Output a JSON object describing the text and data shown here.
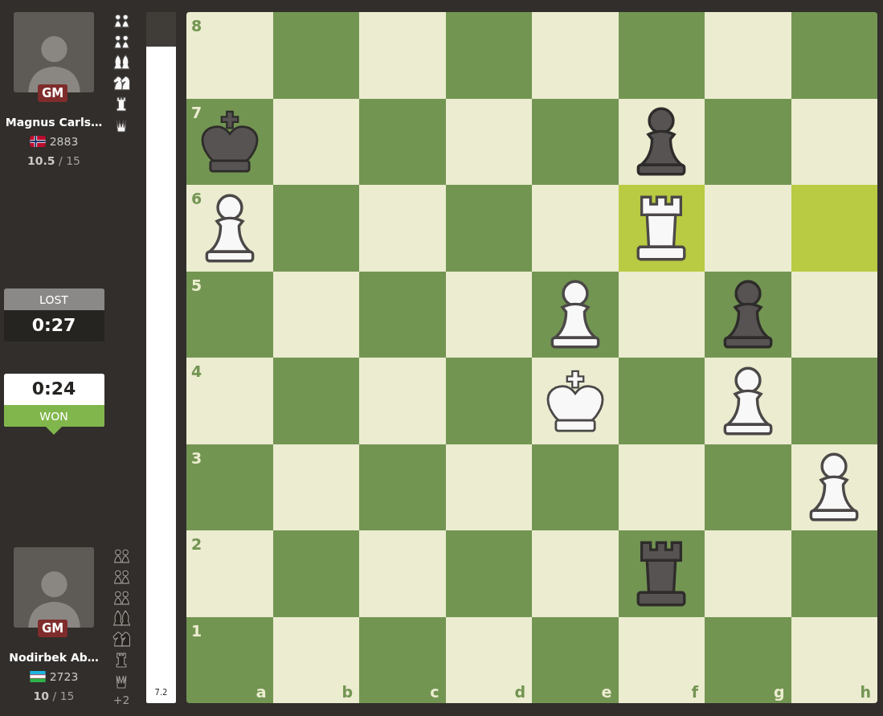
{
  "players": [
    {
      "name": "Magnus Carls…",
      "title": "GM",
      "rating": "2883",
      "score": "**10.5** / 15",
      "captured": [
        {
          "kind": "white_pawn_pair"
        },
        {
          "kind": "white_pawn_pair"
        },
        {
          "kind": "white_bishop_pair"
        },
        {
          "kind": "white_knight_pair"
        },
        {
          "kind": "white_rook"
        },
        {
          "kind": "white_queen"
        }
      ]
    },
    {
      "name": "Nodirbek Ab…",
      "title": "GM",
      "rating": "2723",
      "score": "**10** / 15",
      "captured": [
        {
          "kind": "black_pawn_pair"
        },
        {
          "kind": "black_pawn_pair"
        },
        {
          "kind": "black_pawn_pair"
        },
        {
          "kind": "black_bishop_pair"
        },
        {
          "kind": "black_knight_pair"
        },
        {
          "kind": "black_rook"
        },
        {
          "kind": "black_queen"
        }
      ],
      "advantage": "+2"
    }
  ],
  "clocks": [
    {
      "result": "LOST",
      "time": "0:27",
      "selected": false
    },
    {
      "result": "WON",
      "time": "0:24",
      "selected": true
    }
  ],
  "eval_bar": {
    "level": 0.95,
    "reading": "7.2"
  },
  "board": {
    "rows": [
      {
        "label": "8",
        "squares": [
          {
            "kind": "empty",
            "highlighted": false
          },
          {
            "kind": "empty",
            "highlighted": false
          },
          {
            "kind": "empty",
            "highlighted": false
          },
          {
            "kind": "empty",
            "highlighted": false
          },
          {
            "kind": "empty",
            "highlighted": false
          },
          {
            "kind": "empty",
            "highlighted": false
          },
          {
            "kind": "empty",
            "highlighted": false
          },
          {
            "kind": "empty",
            "highlighted": false
          }
        ]
      },
      {
        "label": "7",
        "squares": [
          {
            "kind": "black_king",
            "highlighted": false
          },
          {
            "kind": "empty",
            "highlighted": false
          },
          {
            "kind": "empty",
            "highlighted": false
          },
          {
            "kind": "empty",
            "highlighted": false
          },
          {
            "kind": "empty",
            "highlighted": false
          },
          {
            "kind": "black_pawn",
            "highlighted": false
          },
          {
            "kind": "empty",
            "highlighted": false
          },
          {
            "kind": "empty",
            "highlighted": false
          }
        ]
      },
      {
        "label": "6",
        "squares": [
          {
            "kind": "white_pawn",
            "highlighted": false
          },
          {
            "kind": "empty",
            "highlighted": false
          },
          {
            "kind": "empty",
            "highlighted": false
          },
          {
            "kind": "empty",
            "highlighted": false
          },
          {
            "kind": "empty",
            "highlighted": false
          },
          {
            "kind": "white_rook",
            "highlighted": true
          },
          {
            "kind": "empty",
            "highlighted": false
          },
          {
            "kind": "empty",
            "highlighted": true
          }
        ]
      },
      {
        "label": "5",
        "squares": [
          {
            "kind": "empty",
            "highlighted": false
          },
          {
            "kind": "empty",
            "highlighted": false
          },
          {
            "kind": "empty",
            "highlighted": false
          },
          {
            "kind": "empty",
            "highlighted": false
          },
          {
            "kind": "white_pawn",
            "highlighted": false
          },
          {
            "kind": "empty",
            "highlighted": false
          },
          {
            "kind": "black_pawn",
            "highlighted": false
          },
          {
            "kind": "empty",
            "highlighted": false
          }
        ]
      },
      {
        "label": "4",
        "squares": [
          {
            "kind": "empty",
            "highlighted": false
          },
          {
            "kind": "empty",
            "highlighted": false
          },
          {
            "kind": "empty",
            "highlighted": false
          },
          {
            "kind": "empty",
            "highlighted": false
          },
          {
            "kind": "white_king",
            "highlighted": false
          },
          {
            "kind": "empty",
            "highlighted": false
          },
          {
            "kind": "white_pawn",
            "highlighted": false
          },
          {
            "kind": "empty",
            "highlighted": false
          }
        ]
      },
      {
        "label": "3",
        "squares": [
          {
            "kind": "empty",
            "highlighted": false
          },
          {
            "kind": "empty",
            "highlighted": false
          },
          {
            "kind": "empty",
            "highlighted": false
          },
          {
            "kind": "empty",
            "highlighted": false
          },
          {
            "kind": "empty",
            "highlighted": false
          },
          {
            "kind": "empty",
            "highlighted": false
          },
          {
            "kind": "empty",
            "highlighted": false
          },
          {
            "kind": "white_pawn",
            "highlighted": false
          }
        ]
      },
      {
        "label": "2",
        "squares": [
          {
            "kind": "empty",
            "highlighted": false
          },
          {
            "kind": "empty",
            "highlighted": false
          },
          {
            "kind": "empty",
            "highlighted": false
          },
          {
            "kind": "empty",
            "highlighted": false
          },
          {
            "kind": "empty",
            "highlighted": false
          },
          {
            "kind": "black_rook",
            "highlighted": false
          },
          {
            "kind": "empty",
            "highlighted": false
          },
          {
            "kind": "empty",
            "highlighted": false
          }
        ]
      },
      {
        "label": "1",
        "squares": [
          {
            "kind": "empty",
            "highlighted": false,
            "label": "a"
          },
          {
            "kind": "empty",
            "highlighted": false,
            "label": "b"
          },
          {
            "kind": "empty",
            "highlighted": false,
            "label": "c"
          },
          {
            "kind": "empty",
            "highlighted": false,
            "label": "d"
          },
          {
            "kind": "empty",
            "highlighted": false,
            "label": "e"
          },
          {
            "kind": "empty",
            "highlighted": false,
            "label": "f"
          },
          {
            "kind": "empty",
            "highlighted": false,
            "label": "g"
          },
          {
            "kind": "empty",
            "highlighted": false,
            "label": "h"
          }
        ]
      }
    ]
  }
}
